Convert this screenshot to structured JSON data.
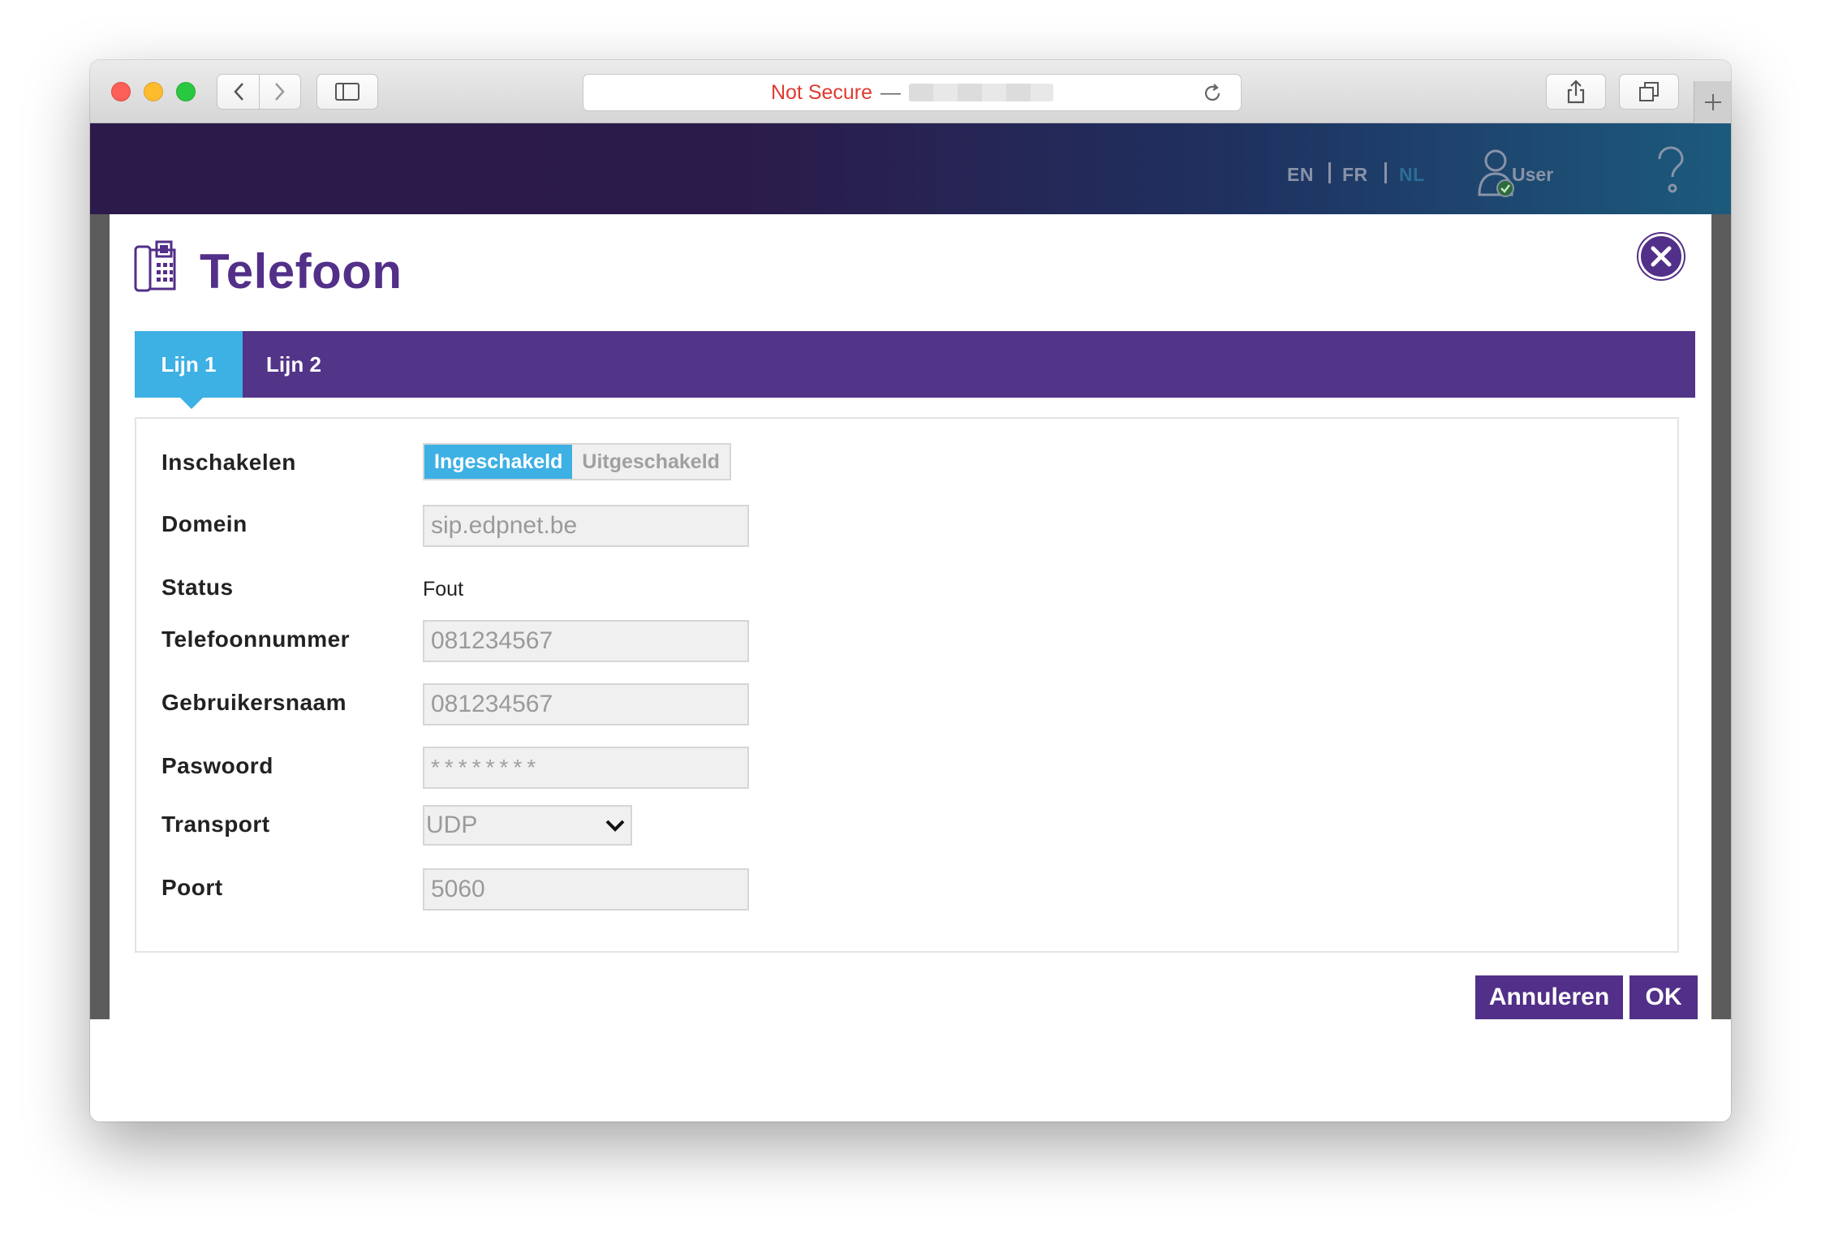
{
  "browser": {
    "address_warning": "Not Secure",
    "address_separator": "—"
  },
  "header": {
    "languages": [
      "EN",
      "FR",
      "NL"
    ],
    "active_language": "NL",
    "user_label": "User"
  },
  "modal": {
    "title": "Telefoon",
    "tabs": [
      {
        "label": "Lijn 1",
        "active": true
      },
      {
        "label": "Lijn 2",
        "active": false
      }
    ],
    "form": {
      "enable": {
        "label": "Inschakelen",
        "on_label": "Ingeschakeld",
        "off_label": "Uitgeschakeld",
        "selected": "Ingeschakeld"
      },
      "domain": {
        "label": "Domein",
        "value": "sip.edpnet.be"
      },
      "status": {
        "label": "Status",
        "value": "Fout"
      },
      "phone": {
        "label": "Telefoonnummer",
        "value": "081234567"
      },
      "username": {
        "label": "Gebruikersnaam",
        "value": "081234567"
      },
      "password": {
        "label": "Paswoord",
        "value": "********"
      },
      "transport": {
        "label": "Transport",
        "value": "UDP"
      },
      "port": {
        "label": "Poort",
        "value": "5060"
      }
    },
    "buttons": {
      "cancel": "Annuleren",
      "ok": "OK"
    }
  },
  "colors": {
    "brand_purple": "#522f88",
    "accent_blue": "#3db0e4",
    "not_secure_red": "#e03a2f"
  }
}
